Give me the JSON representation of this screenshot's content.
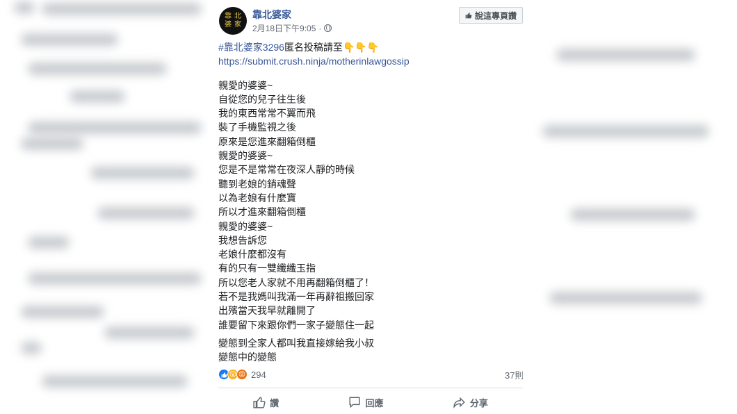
{
  "post": {
    "page_name": "靠北婆家",
    "avatar_chars": [
      "靠",
      "北",
      "婆",
      "家"
    ],
    "timestamp": "2月18日下午9:05",
    "like_page_label": "說這專頁讚",
    "hashtag": "#靠北婆家3296",
    "submit_text": " 匿名投稿請至",
    "submit_link": "https://submit.crush.ninja/motherinlawgossip",
    "lines_a": [
      "親愛的婆婆~",
      "自從您的兒子往生後",
      "我的東西常常不翼而飛",
      "裝了手機監視之後",
      "原來是您進來翻箱倒櫃",
      "親愛的婆婆~",
      "您是不是常常在夜深人靜的時候",
      "聽到老娘的銷魂聲",
      "以為老娘有什麼寶",
      "所以才進來翻箱倒櫃",
      "親愛的婆婆~",
      "我想告訴您",
      "老娘什麼都沒有",
      "有的只有一雙纖纖玉指",
      "所以您老人家就不用再翻箱倒櫃了！",
      "若不是我媽叫我滿一年再辭祖搬回家",
      "出殯當天我早就離開了",
      "誰要留下來跟你們一家子變態住一起"
    ],
    "lines_b": [
      "變態到全家人都叫我直接嫁給我小叔",
      "變態中的變態"
    ],
    "reaction_count": "294",
    "comment_count": "37則",
    "actions": {
      "like": "讚",
      "comment": "回應",
      "share": "分享"
    }
  },
  "colors": {
    "link": "#385898",
    "text": "#1c1e21",
    "meta": "#616770"
  }
}
